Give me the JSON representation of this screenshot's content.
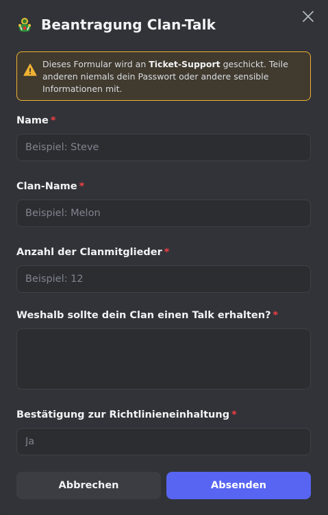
{
  "modal": {
    "title": "Beantragung Clan-Talk",
    "app_icon": "clan-emblem-icon",
    "close_icon": "close-icon"
  },
  "notice": {
    "icon": "warning-icon",
    "text_before": "Dieses Formular wird an ",
    "bold_target": "Ticket-Support",
    "text_after": " geschickt. Teile anderen niemals dein Passwort oder andere sensible Informationen mit.",
    "accent_color": "#f0b232"
  },
  "fields": [
    {
      "label": "Name",
      "required_mark": "*",
      "placeholder": "Beispiel: Steve",
      "value": ""
    },
    {
      "label": "Clan-Name",
      "required_mark": "*",
      "placeholder": "Beispiel: Melon",
      "value": ""
    },
    {
      "label": "Anzahl der Clanmitglieder",
      "required_mark": "*",
      "placeholder": "Beispiel: 12",
      "value": ""
    },
    {
      "label": "Weshalb sollte dein Clan einen Talk erhalten?",
      "required_mark": "*",
      "placeholder": "",
      "value": ""
    },
    {
      "label": "Bestätigung zur Richtlinieneinhaltung",
      "required_mark": "*",
      "placeholder": "Ja",
      "value": ""
    }
  ],
  "buttons": {
    "cancel": "Abbrechen",
    "submit": "Absenden",
    "submit_color": "#5865f2"
  }
}
